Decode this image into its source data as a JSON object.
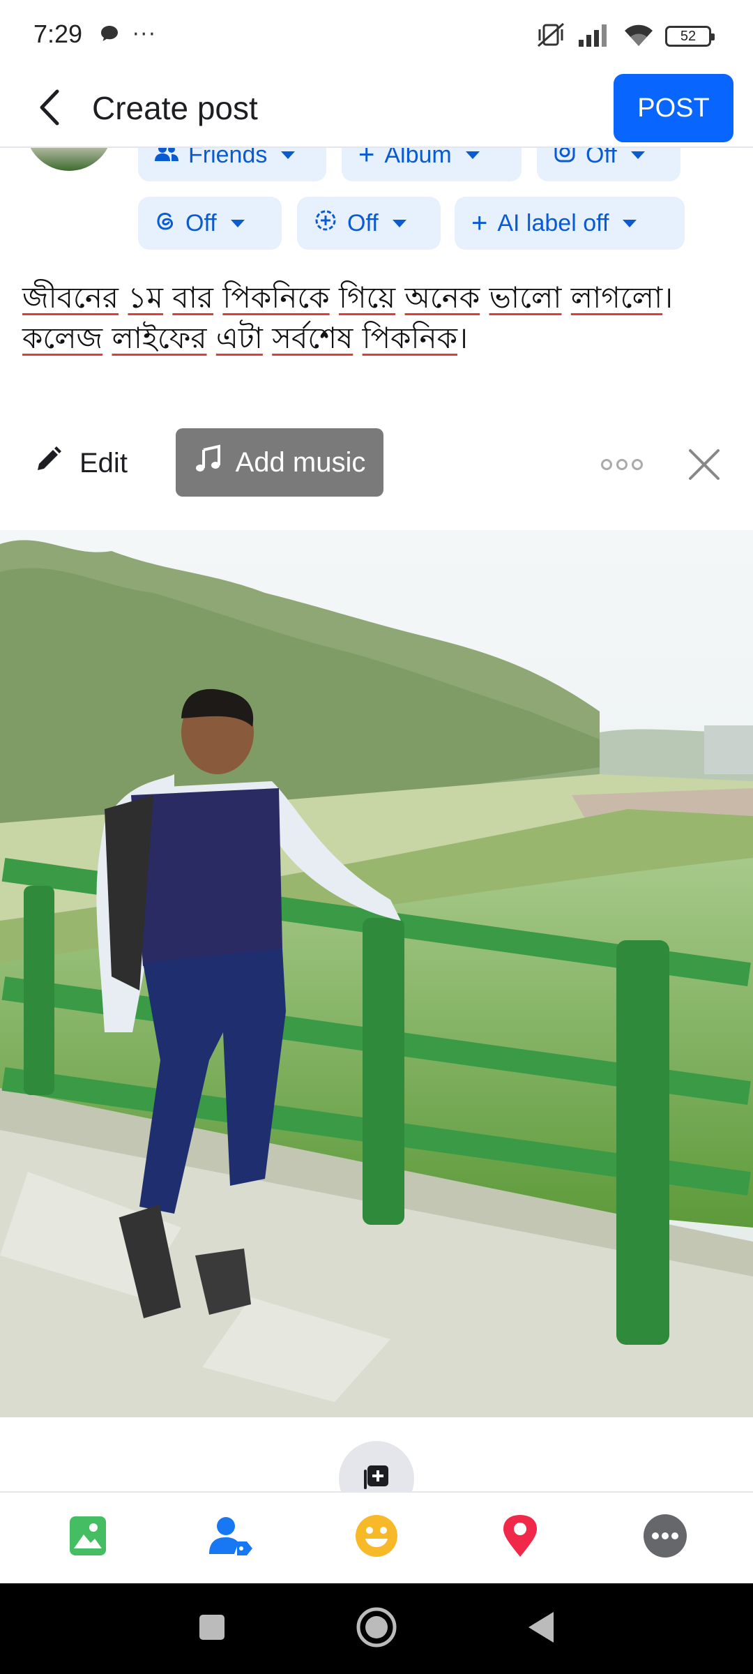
{
  "status_bar": {
    "time": "7:29",
    "more": "···",
    "battery": "52",
    "icons": [
      "chat-bubble-icon",
      "vibrate-off-icon",
      "signal-icon",
      "wifi-icon",
      "battery-icon"
    ]
  },
  "header": {
    "title": "Create post",
    "post_label": "POST",
    "back_icon": "back-arrow-icon"
  },
  "audience": {
    "privacy": "Friends",
    "album": "Album",
    "instagram": "Off",
    "threads": "Off",
    "cross_post": "Off",
    "ai_label": "AI label off"
  },
  "post": {
    "words_line1": [
      "জীবনের",
      "১ম",
      "বার",
      "পিকনিকে",
      "গিয়ে",
      "অনেক",
      "ভালো",
      "লাগলো"
    ],
    "words_line2": [
      "কলেজ",
      "লাইফের",
      "এটা",
      "সর্বশেষ",
      "পিকনিক"
    ],
    "end_mark": "।"
  },
  "media_toolbar": {
    "edit_label": "Edit",
    "music_label": "Add music"
  },
  "action_bar": {
    "items": [
      "photo-icon",
      "tag-people-icon",
      "feeling-icon",
      "location-icon",
      "more-options-icon"
    ]
  },
  "colors": {
    "accent": "#0866ff",
    "chip_bg": "#e7f0fd",
    "chip_text": "#0a5ad1",
    "photo_green": "#4caf50",
    "tag_blue": "#1877f2",
    "feeling_yellow": "#f7b928",
    "location_red": "#f02849",
    "more_gray": "#65676b"
  }
}
